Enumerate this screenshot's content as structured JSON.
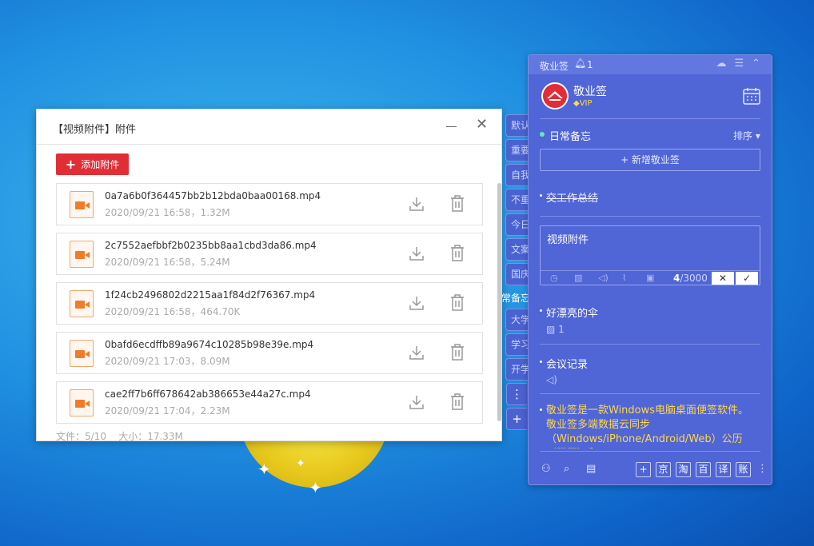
{
  "attach_window": {
    "title": "【视频附件】附件",
    "add_button": "添加附件",
    "files": [
      {
        "name": "0a7a6b0f364457bb2b12bda0baa00168.mp4",
        "meta": "2020/09/21 16:58，1.32M"
      },
      {
        "name": "2c7552aefbbf2b0235bb8aa1cbd3da86.mp4",
        "meta": "2020/09/21 16:58，5.24M"
      },
      {
        "name": "1f24cb2496802d2215aa1f84d2f76367.mp4",
        "meta": "2020/09/21 16:58，464.70K"
      },
      {
        "name": "0bafd6ecdffb89a9674c10285b98e39e.mp4",
        "meta": "2020/09/21 17:03，8.09M"
      },
      {
        "name": "cae2ff7b6ff678642ab386653e44a27c.mp4",
        "meta": "2020/09/21 17:04，2.23M"
      }
    ],
    "footer": "文件：5/10    大小：17.33M"
  },
  "side_tabs": {
    "group1": [
      "默认",
      "重要",
      "自我",
      "不重",
      "今日",
      "文案",
      "国庆"
    ],
    "heading": "常备忘",
    "group2": [
      "大学",
      "学习",
      "开学"
    ],
    "more": "⋮",
    "add": "+"
  },
  "note_panel": {
    "app_name": "敬业签",
    "notify_count": "1",
    "user_name": "敬业签",
    "vip": "VIP",
    "section": "日常备忘",
    "sort": "排序",
    "new_button": "+ 新增敬业签",
    "note1": "交工作总结",
    "editor_text": "视频附件",
    "counter_value": "4",
    "counter_max": "/3000",
    "cancel": "✕",
    "confirm": "✓",
    "note2": "好漂亮的伞",
    "note2_sub": "1",
    "note3": "会议记录",
    "note4": "敬业签是一款Windows电脑桌面便签软件。敬业签多端数据云同步（Windows/iPhone/Android/Web）公历（阳历）和",
    "bottom_boxes": [
      "+",
      "京",
      "淘",
      "百",
      "译",
      "账"
    ]
  },
  "colors": {
    "panel_bg": "#5065d6",
    "accent_red": "#e12e36",
    "highlight_yellow": "#ffd84a"
  }
}
